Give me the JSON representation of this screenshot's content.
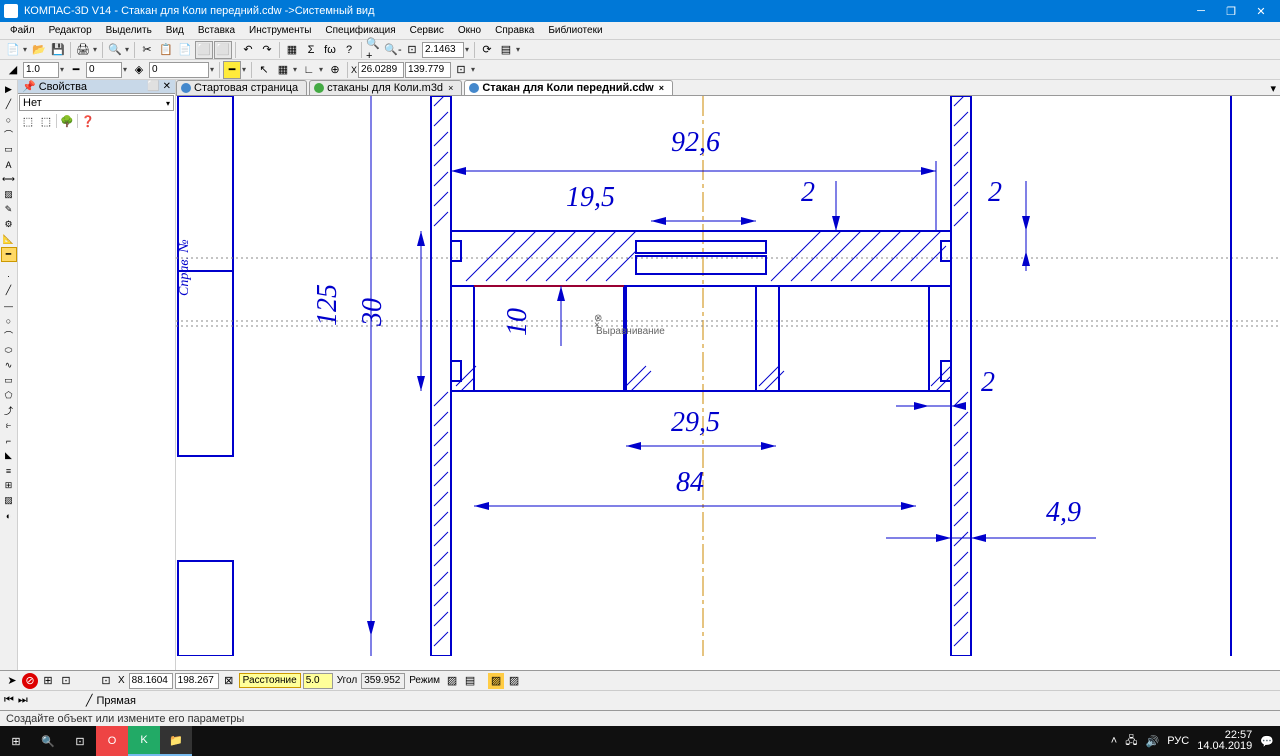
{
  "title": "КОМПАС-3D V14 - Стакан для Коли передний.cdw ->Системный вид",
  "menu": [
    "Файл",
    "Редактор",
    "Выделить",
    "Вид",
    "Вставка",
    "Инструменты",
    "Спецификация",
    "Сервис",
    "Окно",
    "Справка",
    "Библиотеки"
  ],
  "toolbar1": {
    "zoom_value": "2.1463",
    "coord_x": "26.0289",
    "coord_y": "139.779"
  },
  "toolbar2": {
    "input1": "1.0",
    "input2": "0",
    "input3": "0"
  },
  "side_panel": {
    "title": "Свойства",
    "combo": "Нет"
  },
  "tabs": [
    {
      "label": "Стартовая страница",
      "icon": "#4488cc",
      "active": false
    },
    {
      "label": "стаканы для Коли.m3d",
      "icon": "#44aa44",
      "active": false
    },
    {
      "label": "Стакан для Коли передний.cdw",
      "icon": "#4488cc",
      "active": true
    }
  ],
  "dimensions": {
    "d926": "92,6",
    "d195": "19,5",
    "d2a": "2",
    "d2b": "2",
    "d125": "125",
    "d30": "30",
    "d10": "10",
    "d295": "29,5",
    "d84": "84",
    "d2c": "2",
    "d49": "4,9",
    "tooltip": "Выравнивание"
  },
  "bottom": {
    "x": "88.1604",
    "y": "198.267",
    "dist_label": "Расстояние",
    "dist_val": "5.0",
    "angle_label": "Угол",
    "angle_val": "359.952",
    "mode_label": "Режим",
    "tool_label": "Прямая"
  },
  "status": "Создайте объект или измените его параметры",
  "tray": {
    "lang": "РУС",
    "time": "22:57",
    "date": "14.04.2019"
  },
  "chart_data": {
    "type": "diagram",
    "description": "CAD mechanical drawing section view",
    "measurements": [
      92.6,
      19.5,
      2,
      2,
      125,
      30,
      10,
      29.5,
      84,
      2,
      4.9
    ]
  }
}
